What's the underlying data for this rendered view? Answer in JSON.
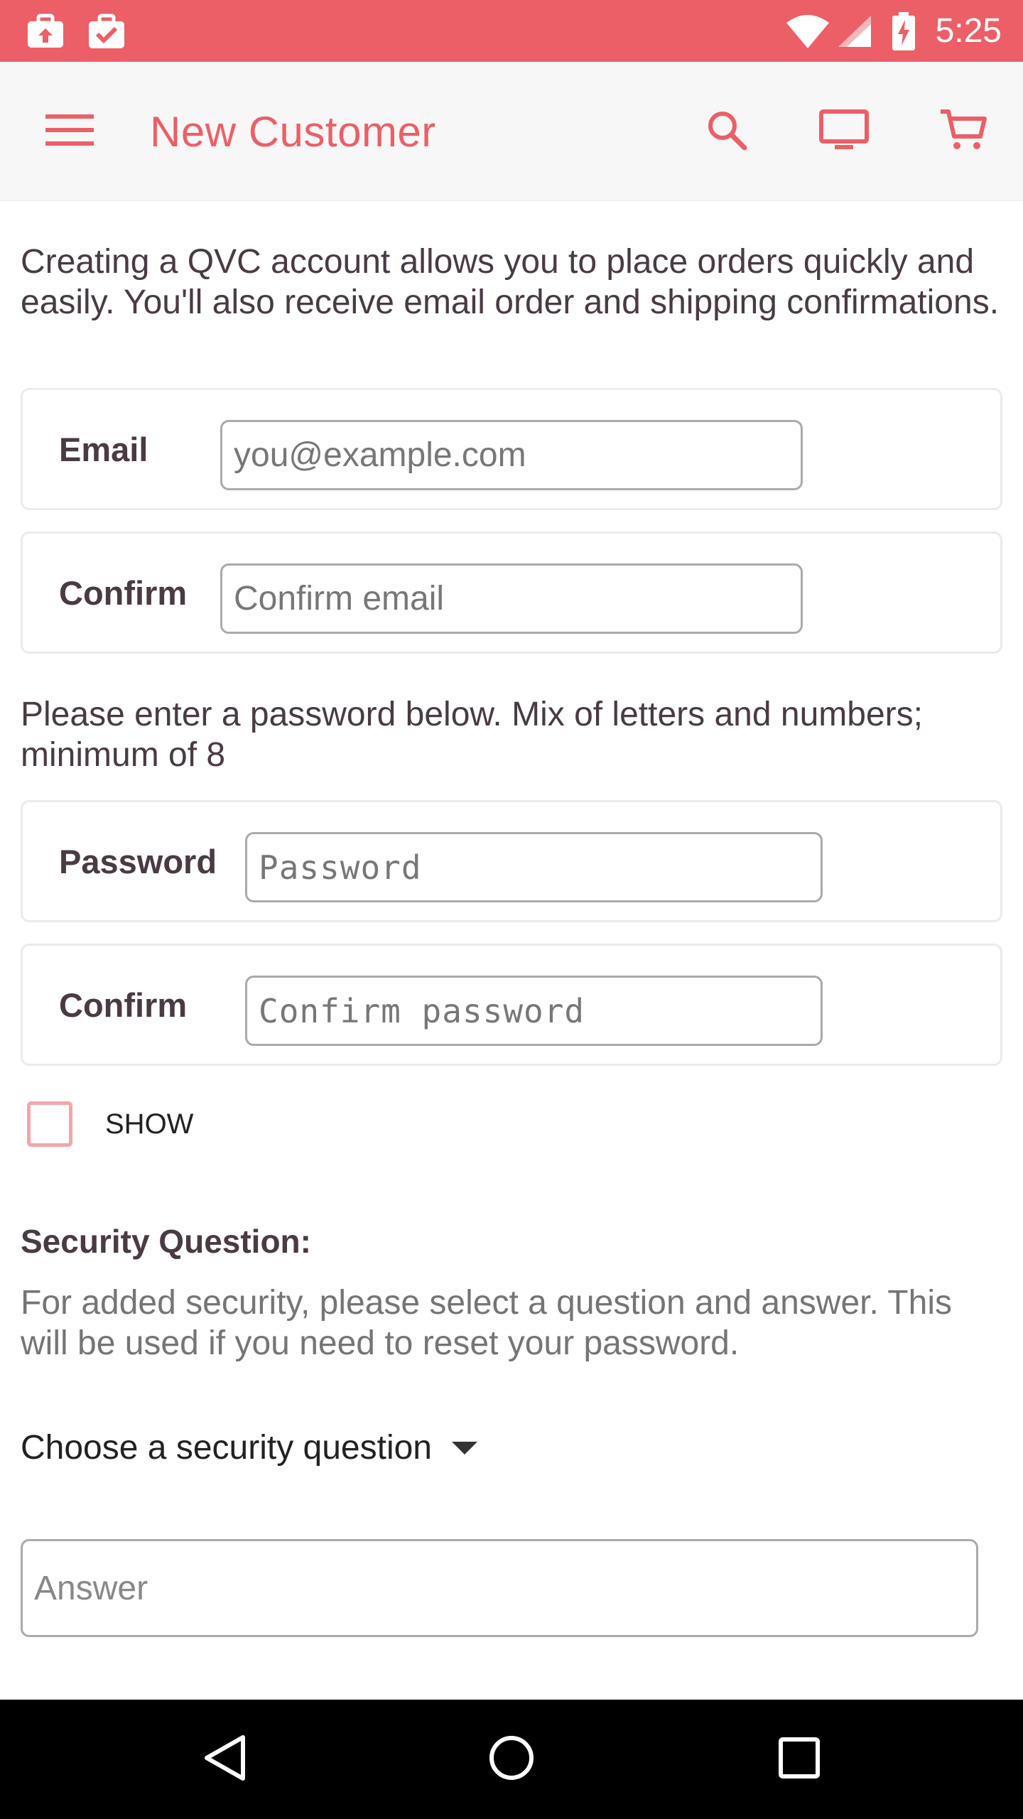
{
  "status_bar": {
    "time": "5:25",
    "icons": [
      "briefcase-upload-icon",
      "briefcase-check-icon",
      "wifi-icon",
      "signal-icon",
      "battery-charging-icon"
    ]
  },
  "app_bar": {
    "title": "New Customer",
    "icons": [
      "menu-icon",
      "search-icon",
      "tv-icon",
      "cart-icon"
    ],
    "accent_color": "#ec5f67"
  },
  "intro_text": "Creating a QVC account allows you to place orders quickly and easily. You'll also receive email order and shipping confirmations.",
  "email_card": {
    "label": "Email",
    "placeholder": "you@example.com",
    "value": ""
  },
  "confirm_email_card": {
    "label": "Confirm",
    "placeholder": "Confirm email",
    "value": ""
  },
  "password_note": "Please enter a password below. Mix of letters and numbers; minimum of 8",
  "password_card": {
    "label": "Password",
    "placeholder": "Password",
    "value": ""
  },
  "confirm_password_card": {
    "label": "Confirm",
    "placeholder": "Confirm password",
    "value": ""
  },
  "show_checkbox": {
    "label": "SHOW",
    "checked": false
  },
  "security": {
    "title": "Security Question:",
    "description": "For added security, please select a question and answer. This will be used if you need to reset your password.",
    "dropdown_selected": "Choose a security question",
    "answer_placeholder": "Answer"
  },
  "nav_bar": {
    "icons": [
      "back-icon",
      "home-icon",
      "recents-icon"
    ]
  }
}
